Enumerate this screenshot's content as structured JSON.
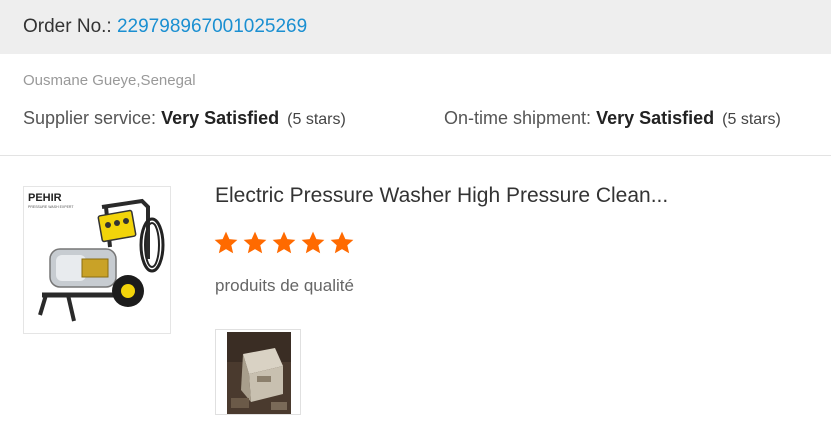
{
  "order": {
    "label": "Order No.: ",
    "number": "229798967001025269"
  },
  "review": {
    "buyer": "Ousmane Gueye,Senegal",
    "supplier_service": {
      "label": "Supplier service: ",
      "value": "Very Satisfied",
      "stars_note": "(5 stars)"
    },
    "on_time_shipment": {
      "label": "On-time shipment: ",
      "value": "Very Satisfied",
      "stars_note": "(5 stars)"
    }
  },
  "product": {
    "title": "Electric Pressure Washer High Pressure Clean...",
    "rating": 5,
    "comment": "produits de qualité",
    "thumbnail_logo": "PEHIR",
    "thumbnail_logo_sub": "PRESSURE WASH EXPERT",
    "thumbnail_icon": "pressure-washer-image",
    "review_photo_icon": "customer-photo-image",
    "star_color": "#ff6a00"
  }
}
